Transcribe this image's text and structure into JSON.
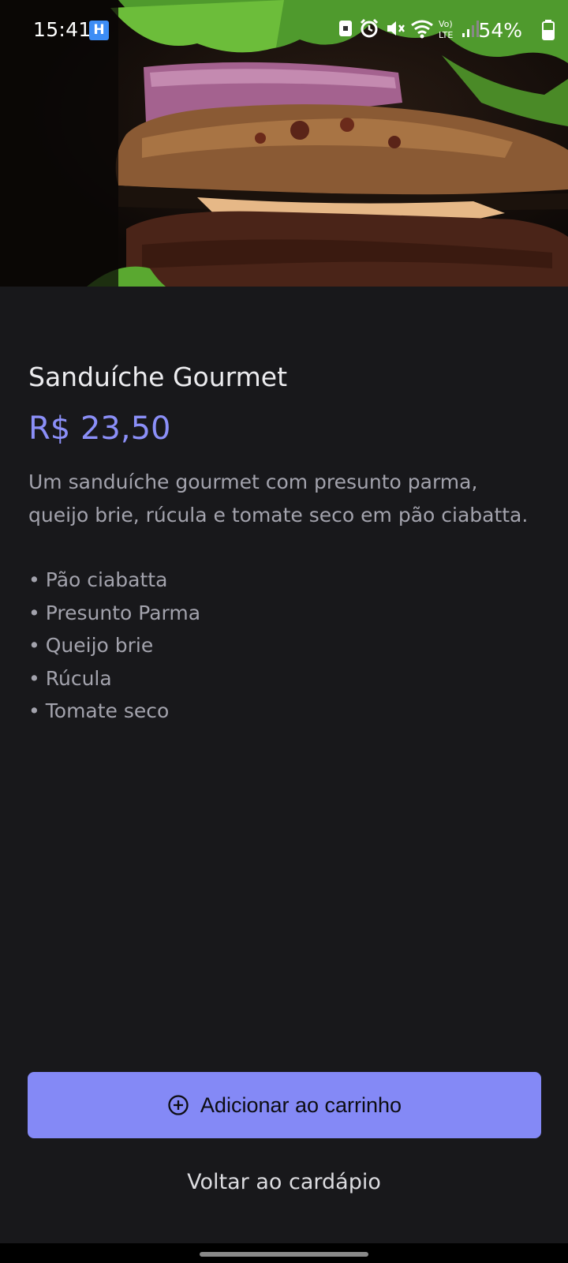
{
  "status_bar": {
    "time": "15:41",
    "app_badge_letter": "H",
    "battery_percent": "54%",
    "signal": "Vo) LTE"
  },
  "hero": {
    "icon": "burger-photo"
  },
  "product": {
    "title": "Sanduíche Gourmet",
    "price": "R$ 23,50",
    "description": "Um sanduíche gourmet com presunto parma, queijo brie, rúcula e tomate seco em pão ciabatta.",
    "ingredients": [
      "Pão ciabatta",
      "Presunto Parma",
      "Queijo brie",
      "Rúcula",
      "Tomate seco"
    ],
    "bullet": "•"
  },
  "actions": {
    "add_to_cart_label": "Adicionar ao carrinho",
    "add_icon": "plus-circle-icon",
    "back_label": "Voltar ao cardápio"
  },
  "colors": {
    "background": "#18181b",
    "accent": "#8489f6",
    "price": "#8b8ff8"
  }
}
